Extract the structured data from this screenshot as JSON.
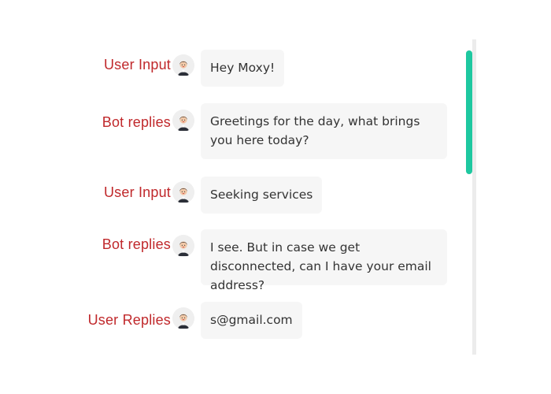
{
  "chat": {
    "messages": [
      {
        "annotation": "User Input",
        "text": "Hey Moxy!"
      },
      {
        "annotation": "Bot replies",
        "text": "Greetings for the day, what brings you here today?"
      },
      {
        "annotation": "User Input",
        "text": "Seeking services"
      },
      {
        "annotation": "Bot replies",
        "text": "I see. But in case we get disconnected, can I have your email address?"
      },
      {
        "annotation": "User Replies",
        "text": "s@gmail.com"
      }
    ]
  },
  "colors": {
    "annotation": "#c0282b",
    "bubble_background": "#f6f6f6",
    "scroll_thumb": "#1ec8a0"
  },
  "icons": {
    "avatar": "woman-avatar-icon"
  }
}
